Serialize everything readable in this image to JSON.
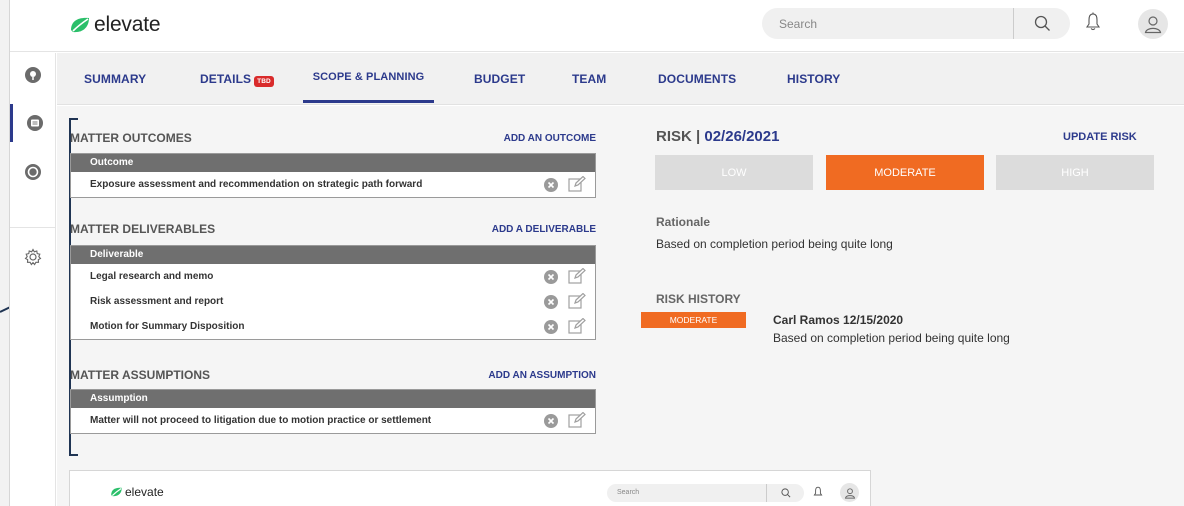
{
  "app": {
    "logo_text": "elevate",
    "brand_green": "#2bbf6a",
    "accent_blue": "#2c3a8c",
    "accent_orange": "#f06b22"
  },
  "header": {
    "search_placeholder": "Search",
    "icons": [
      "search-icon",
      "bell-icon",
      "user-icon"
    ]
  },
  "rail": {
    "items": [
      "location-icon",
      "document-icon",
      "target-icon",
      "gear-icon"
    ],
    "active": "document-icon"
  },
  "tabs": [
    {
      "label": "SUMMARY"
    },
    {
      "label": "DETAILS",
      "badge": "TBD"
    },
    {
      "label": "SCOPE & PLANNING",
      "active": true
    },
    {
      "label": "BUDGET"
    },
    {
      "label": "TEAM"
    },
    {
      "label": "DOCUMENTS"
    },
    {
      "label": "HISTORY"
    }
  ],
  "outcomes": {
    "title": "MATTER OUTCOMES",
    "action": "ADD AN OUTCOME",
    "column": "Outcome",
    "rows": [
      "Exposure assessment and recommendation on strategic path forward"
    ]
  },
  "deliverables": {
    "title": "MATTER DELIVERABLES",
    "action": "ADD A DELIVERABLE",
    "column": "Deliverable",
    "rows": [
      "Legal research and memo",
      "Risk assessment and report",
      "Motion for Summary Disposition"
    ]
  },
  "assumptions": {
    "title": "MATTER ASSUMPTIONS",
    "action": "ADD AN ASSUMPTION",
    "column": "Assumption",
    "rows": [
      "Matter will not proceed to litigation due to motion practice or settlement"
    ]
  },
  "risk": {
    "label": "RISK |",
    "date": "02/26/2021",
    "update": "UPDATE RISK",
    "levels": [
      "LOW",
      "MODERATE",
      "HIGH"
    ],
    "selected": "MODERATE",
    "rationale_label": "Rationale",
    "rationale": "Based on completion period being quite long",
    "history_label": "RISK HISTORY",
    "history": [
      {
        "level": "MODERATE",
        "author": "Carl Ramos 12/15/2020",
        "text": "Based on completion period being quite long"
      }
    ]
  },
  "mini": {
    "logo_text": "elevate",
    "search_placeholder": "Search"
  }
}
